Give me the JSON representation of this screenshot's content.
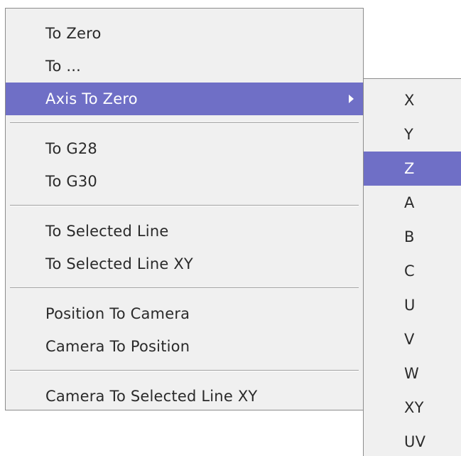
{
  "main_menu": {
    "items": [
      {
        "label": "To Zero"
      },
      {
        "label": "To ..."
      },
      {
        "label": "Axis To Zero",
        "has_submenu": true,
        "active": true
      },
      {
        "label": "To G28"
      },
      {
        "label": "To G30"
      },
      {
        "label": "To Selected Line"
      },
      {
        "label": "To Selected Line XY"
      },
      {
        "label": "Position To Camera"
      },
      {
        "label": "Camera To Position"
      },
      {
        "label": "Camera To Selected Line XY"
      }
    ],
    "submenu_arrow_icon": "chevron-right-icon"
  },
  "sub_menu": {
    "items": [
      {
        "label": "X"
      },
      {
        "label": "Y"
      },
      {
        "label": "Z",
        "active": true
      },
      {
        "label": "A"
      },
      {
        "label": "B"
      },
      {
        "label": "C"
      },
      {
        "label": "U"
      },
      {
        "label": "V"
      },
      {
        "label": "W"
      },
      {
        "label": "XY"
      },
      {
        "label": "UV"
      }
    ]
  },
  "colors": {
    "menu_background": "#f0f0f0",
    "highlight": "#6f6fc6",
    "highlight_text": "#ffffff",
    "text": "#2a2a2a",
    "border": "#8c8c8c"
  }
}
